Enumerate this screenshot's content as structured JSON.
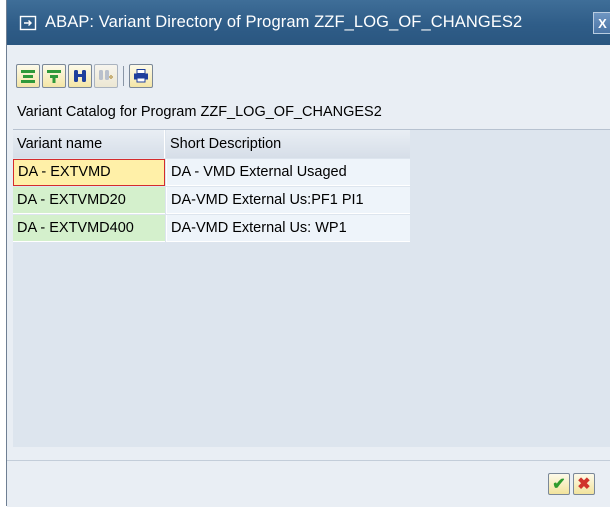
{
  "window": {
    "title": "ABAP: Variant Directory of Program ZZF_LOG_OF_CHANGES2",
    "close_glyph": "X"
  },
  "toolbar": {
    "buttons": [
      {
        "icon": "expand-subtree-icon",
        "enabled": true
      },
      {
        "icon": "filter-icon",
        "enabled": true
      },
      {
        "icon": "find-binoculars-icon",
        "enabled": true
      },
      {
        "icon": "find-next-icon",
        "enabled": false
      },
      {
        "icon": "print-icon",
        "enabled": true
      }
    ]
  },
  "catalog_title": "Variant Catalog for Program ZZF_LOG_OF_CHANGES2",
  "table": {
    "headers": [
      "Variant name",
      "Short Description"
    ],
    "rows": [
      {
        "name": "DA - EXTVMD",
        "desc": "DA - VMD External Usaged"
      },
      {
        "name": "DA - EXTVMD20",
        "desc": "DA-VMD External Us:PF1 PI1"
      },
      {
        "name": "DA - EXTVMD400",
        "desc": "DA-VMD External Us: WP1"
      }
    ]
  },
  "footer": {
    "ok_glyph": "✔",
    "cancel_glyph": "✖"
  },
  "colors": {
    "titlebar": "#2f5d88",
    "row_name_bg": "#d4f0cc",
    "selected_bg": "#fff0a8",
    "ok_green": "#2e9b2e",
    "cancel_red": "#d0342c"
  }
}
